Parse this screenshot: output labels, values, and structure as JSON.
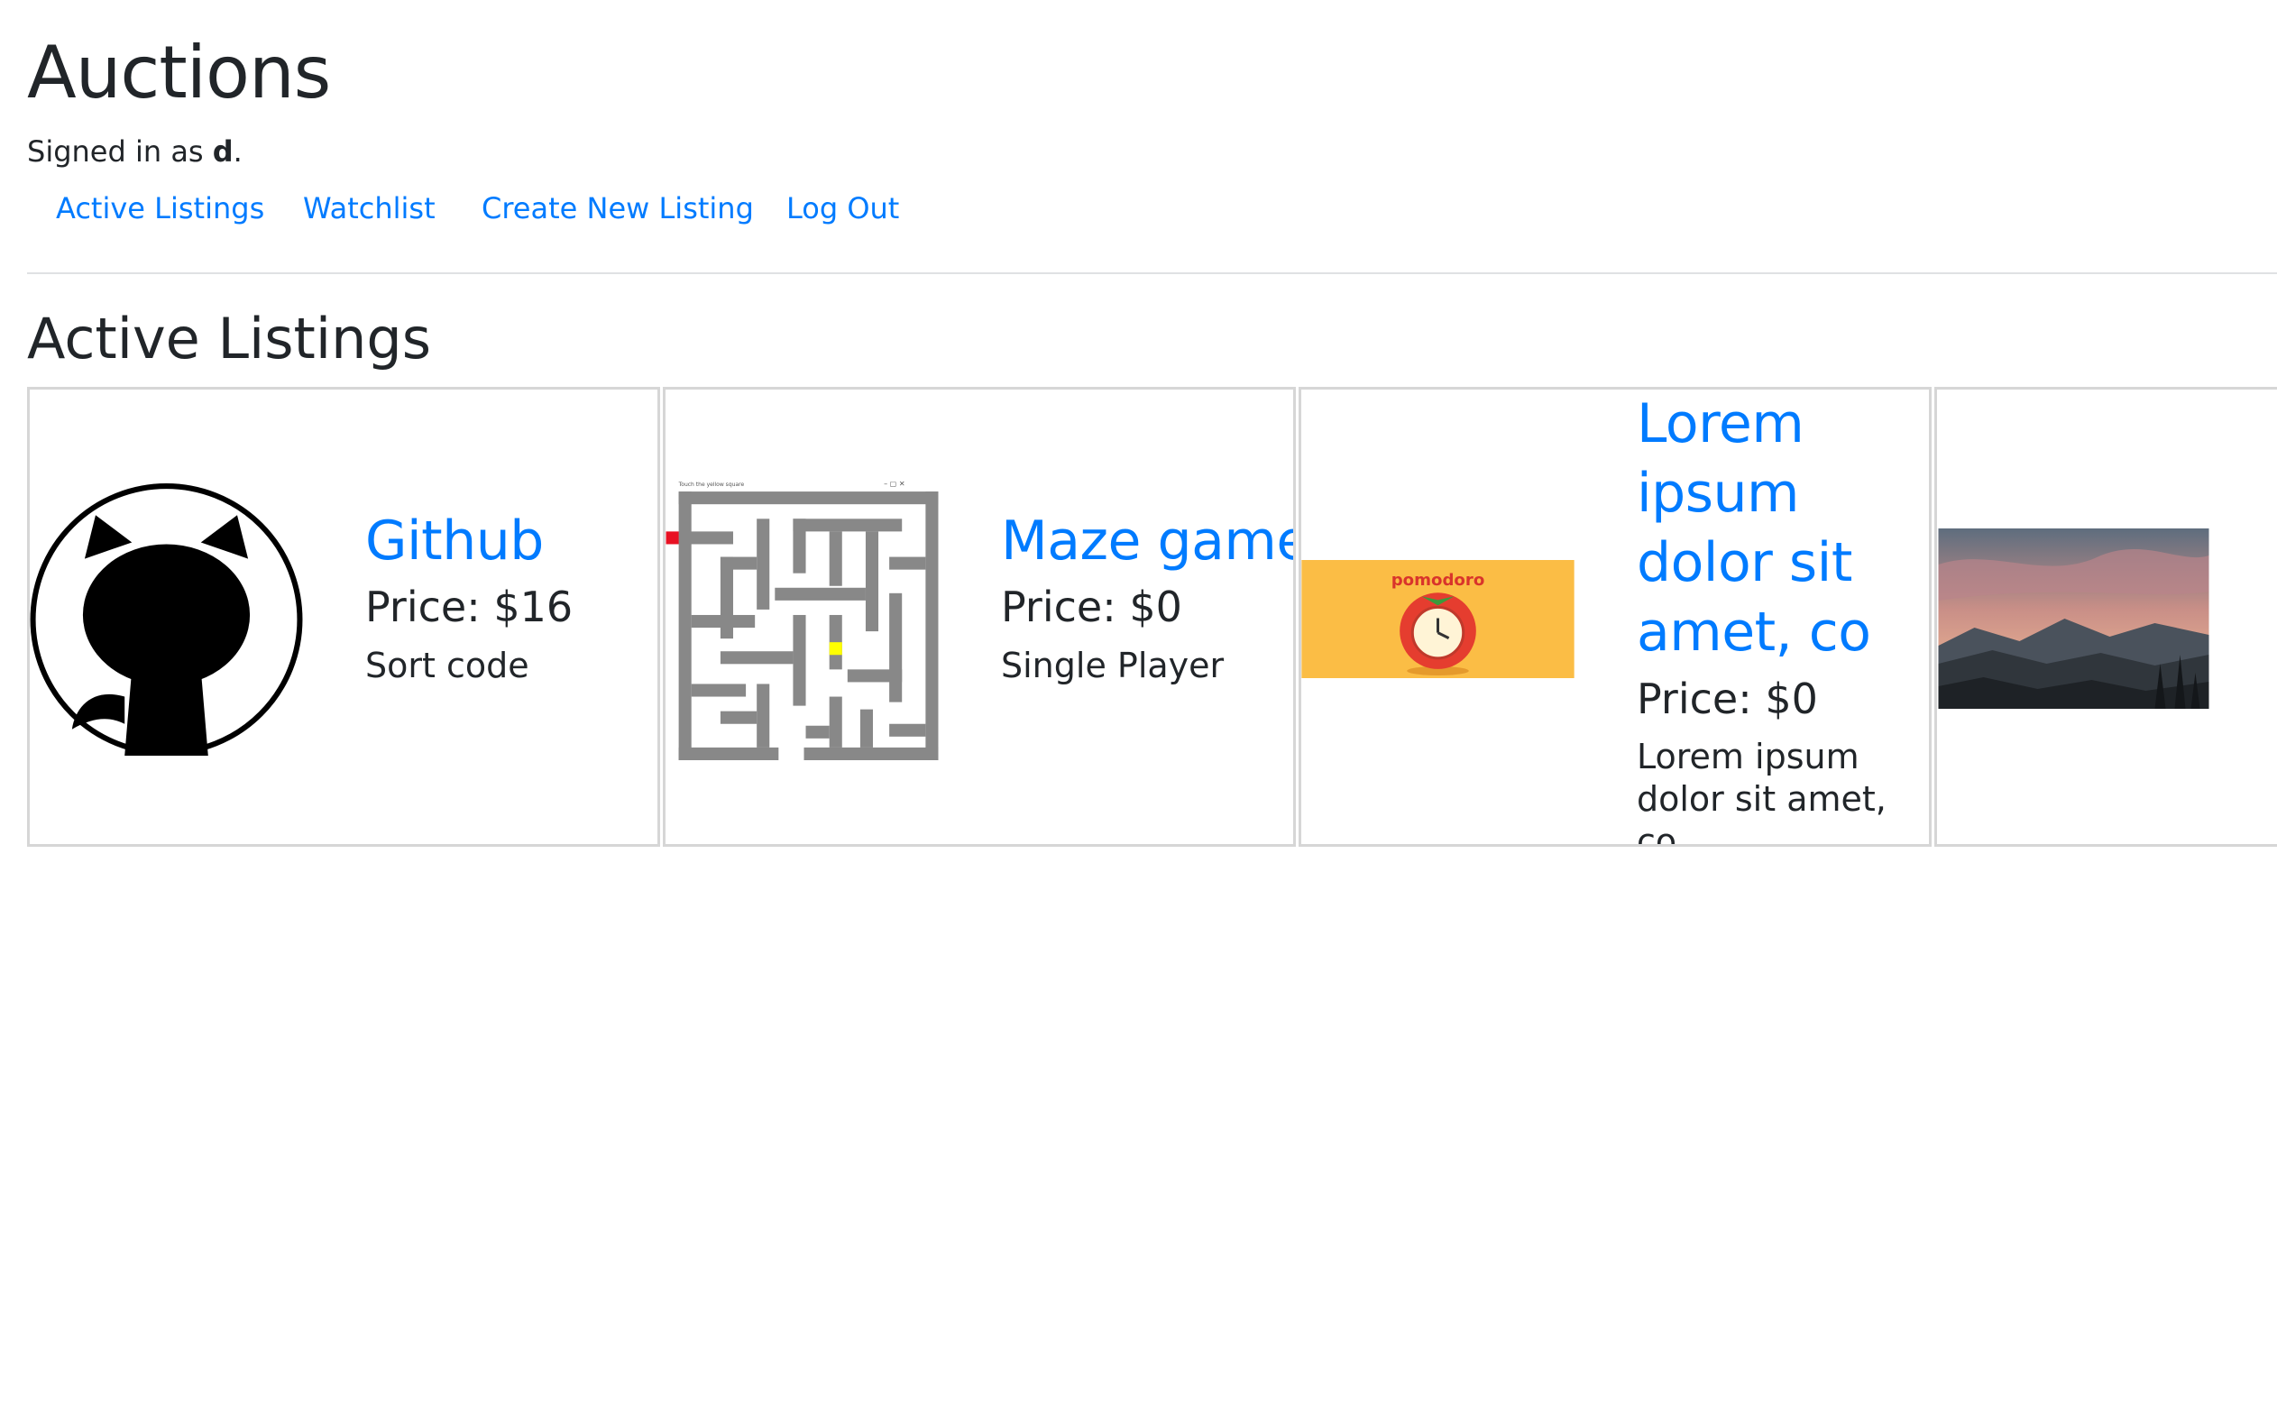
{
  "app": {
    "title": "Auctions"
  },
  "user": {
    "prefix": "Signed in as ",
    "name": "d",
    "suffix": "."
  },
  "nav": {
    "active_listings": "Active Listings",
    "watchlist": "Watchlist",
    "create_listing": "Create New Listing",
    "logout": "Log Out"
  },
  "section": {
    "title": "Active Listings"
  },
  "listings": [
    {
      "title": "Github",
      "price": "Price: $16",
      "description": "Sort code",
      "image": "github-logo",
      "image_window_title": "Touch the yellow square"
    },
    {
      "title": "Maze game",
      "price": "Price: $0",
      "description": "Single Player",
      "image": "maze-screenshot"
    },
    {
      "title": "Lorem ipsum dolor sit amet, co",
      "price": "Price: $0",
      "description": "Lorem ipsum dolor sit amet, co",
      "image": "pomodoro-banner",
      "image_text": "pomodoro"
    },
    {
      "title": "",
      "price": "",
      "description": "",
      "image": "mountain-sunset-photo"
    }
  ],
  "colors": {
    "link": "#007bff",
    "text": "#212529",
    "border": "#d6d6d6",
    "maze_wall": "#888888",
    "pomodoro_bg": "#fbbd45"
  },
  "maze_caption": "Touch the yellow square"
}
